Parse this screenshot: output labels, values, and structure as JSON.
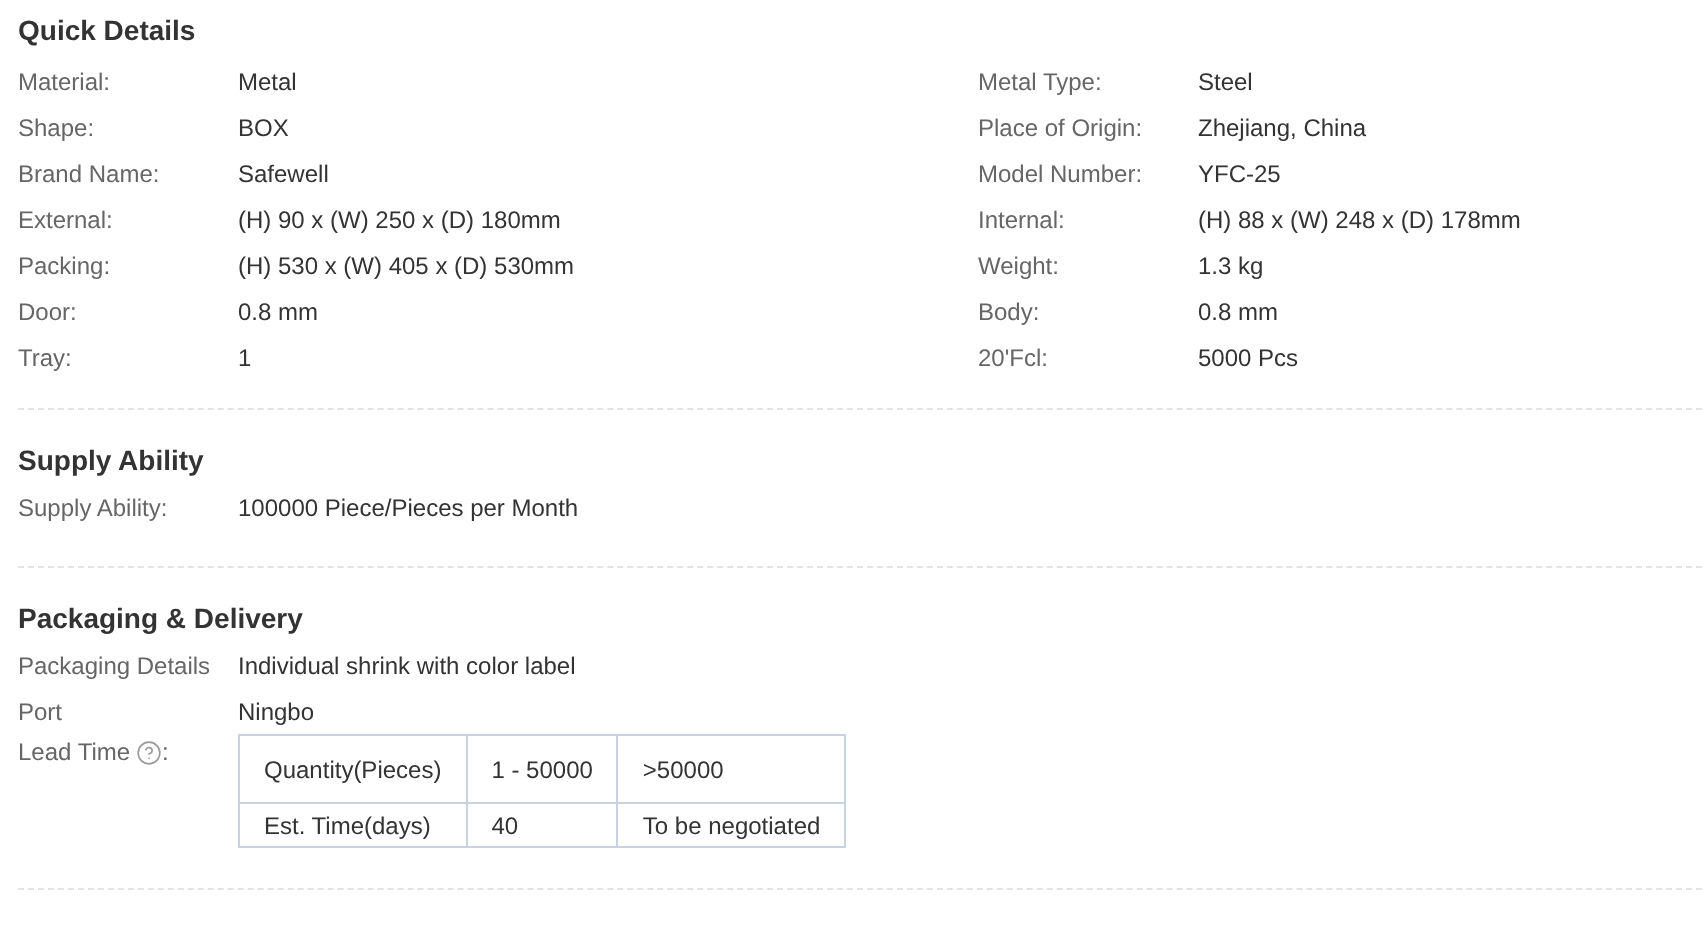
{
  "quick_details": {
    "title": "Quick Details",
    "left": [
      {
        "label": "Material:",
        "value": "Metal"
      },
      {
        "label": "Shape:",
        "value": "BOX"
      },
      {
        "label": "Brand Name:",
        "value": "Safewell"
      },
      {
        "label": "External:",
        "value": "(H) 90 x (W) 250 x (D) 180mm"
      },
      {
        "label": "Packing:",
        "value": "(H) 530 x (W) 405 x (D) 530mm"
      },
      {
        "label": "Door:",
        "value": "0.8 mm"
      },
      {
        "label": "Tray:",
        "value": "1"
      }
    ],
    "right": [
      {
        "label": "Metal Type:",
        "value": "Steel"
      },
      {
        "label": "Place of Origin:",
        "value": "Zhejiang, China"
      },
      {
        "label": "Model Number:",
        "value": "YFC-25"
      },
      {
        "label": "Internal:",
        "value": "(H) 88 x (W) 248 x (D) 178mm"
      },
      {
        "label": "Weight:",
        "value": "1.3 kg"
      },
      {
        "label": "Body:",
        "value": "0.8 mm"
      },
      {
        "label": "20'Fcl:",
        "value": "5000 Pcs"
      }
    ]
  },
  "supply_ability": {
    "title": "Supply Ability",
    "rows": [
      {
        "label": "Supply Ability:",
        "value": "100000 Piece/Pieces per Month"
      }
    ]
  },
  "packaging_delivery": {
    "title": "Packaging & Delivery",
    "rows": [
      {
        "label": "Packaging Details",
        "value": "Individual shrink with color label"
      },
      {
        "label": "Port",
        "value": "Ningbo"
      }
    ],
    "lead_time": {
      "label": "Lead Time",
      "suffix": ":",
      "table": [
        [
          "Quantity(Pieces)",
          "1 - 50000",
          ">50000"
        ],
        [
          "Est. Time(days)",
          "40",
          "To be negotiated"
        ]
      ]
    }
  }
}
